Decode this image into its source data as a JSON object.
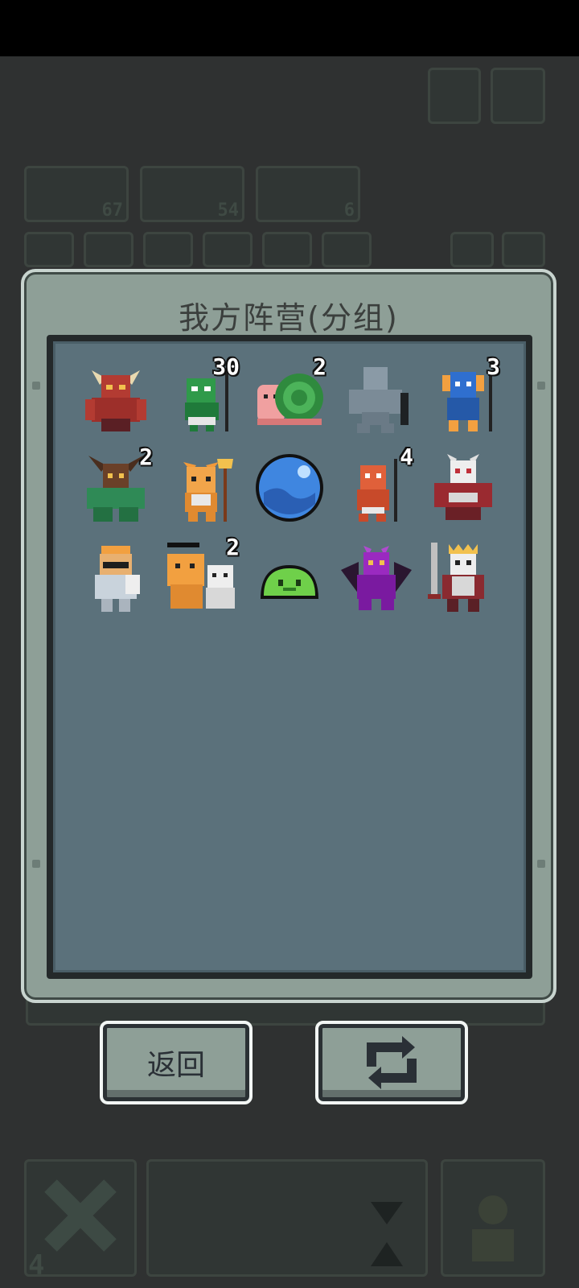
{
  "dialog": {
    "title": "我方阵营(分组)"
  },
  "units": [
    {
      "name": "minotaur-unit",
      "count": ""
    },
    {
      "name": "goblin-spearman-unit",
      "count": "30"
    },
    {
      "name": "snail-unit",
      "count": "2"
    },
    {
      "name": "stone-golem-unit",
      "count": ""
    },
    {
      "name": "blue-lizard-warrior-unit",
      "count": "3"
    },
    {
      "name": "horned-druid-unit",
      "count": "2"
    },
    {
      "name": "fox-trident-unit",
      "count": ""
    },
    {
      "name": "water-orb-unit",
      "count": ""
    },
    {
      "name": "red-lizard-spearman-unit",
      "count": "4"
    },
    {
      "name": "skull-knight-unit",
      "count": ""
    },
    {
      "name": "armored-knight-unit",
      "count": ""
    },
    {
      "name": "lion-pair-unit",
      "count": "2"
    },
    {
      "name": "green-slime-unit",
      "count": ""
    },
    {
      "name": "purple-dragon-unit",
      "count": ""
    },
    {
      "name": "skeleton-king-unit",
      "count": ""
    }
  ],
  "buttons": {
    "back_label": "返回",
    "swap_icon": "swap-arrows-icon"
  },
  "background": {
    "counters": [
      "67",
      "54",
      "6"
    ],
    "bottom_count": "4"
  },
  "colors": {
    "dialog_bg": "#8e9f97",
    "panel_bg": "#5b717b",
    "page_bg": "#2f3131"
  }
}
